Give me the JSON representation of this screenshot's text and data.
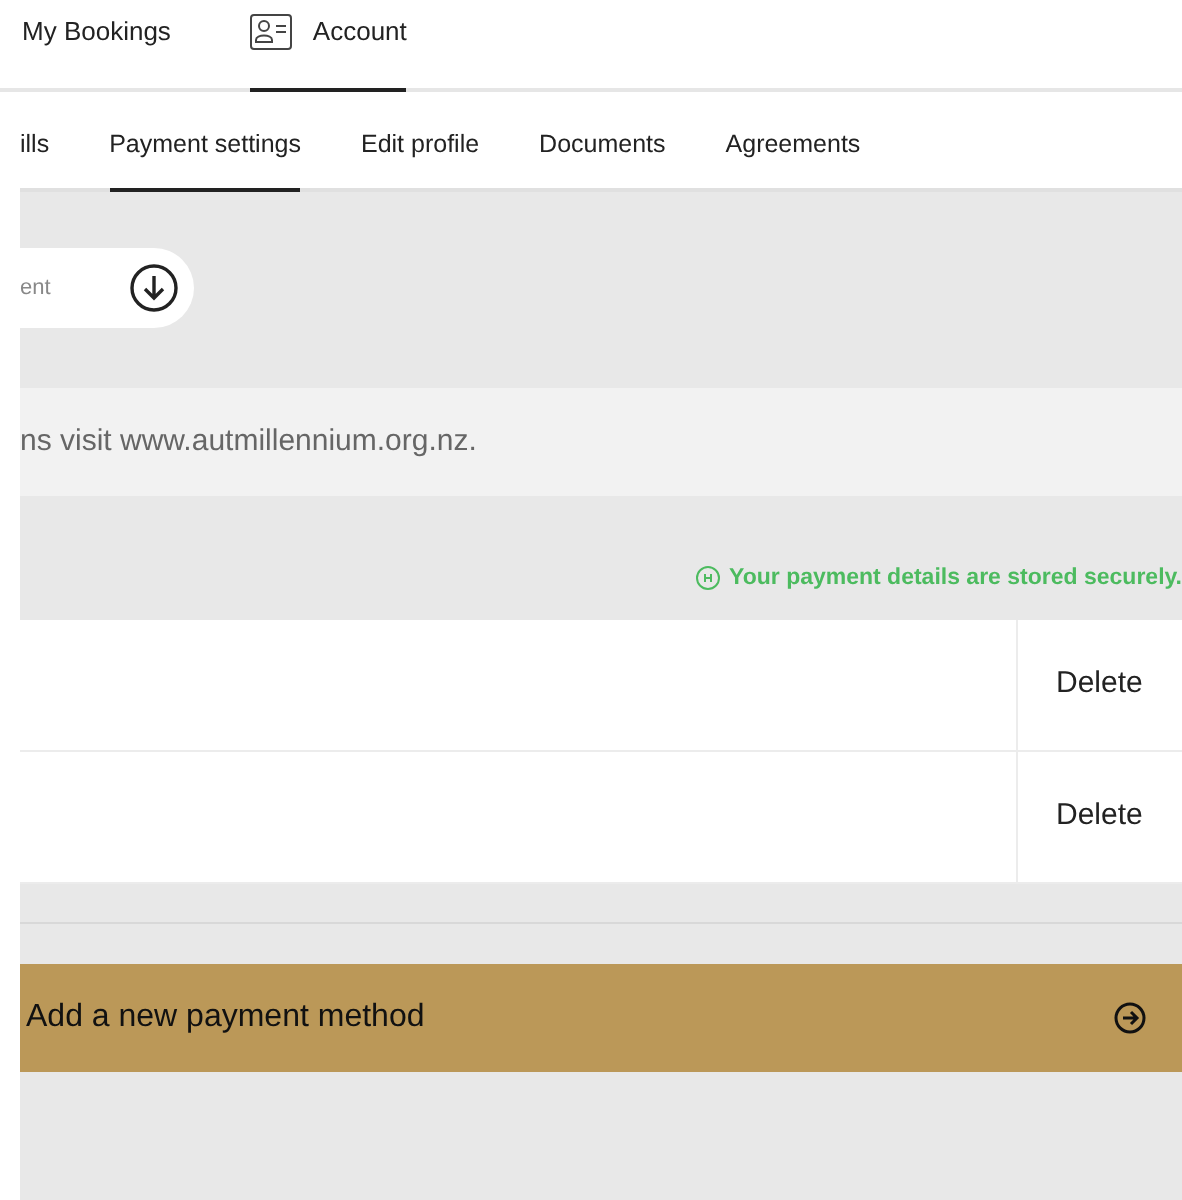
{
  "top_nav": [
    {
      "label": "My Bookings",
      "icon": false,
      "selected": false
    },
    {
      "label": "Account",
      "icon": true,
      "selected": true
    }
  ],
  "tabs": [
    {
      "label": "ills",
      "selected": false
    },
    {
      "label": "Payment settings",
      "selected": true
    },
    {
      "label": "Edit profile",
      "selected": false
    },
    {
      "label": "Documents",
      "selected": false
    },
    {
      "label": "Agreements",
      "selected": false
    }
  ],
  "download_pill": {
    "label": "ent"
  },
  "info_text": "ns visit www.autmillennium.org.nz.",
  "secure_note": "Your payment details are stored securely.",
  "payment_methods": [
    {
      "action": "Delete"
    },
    {
      "action": "Delete"
    }
  ],
  "add_button": {
    "label": "Add a new payment method"
  }
}
